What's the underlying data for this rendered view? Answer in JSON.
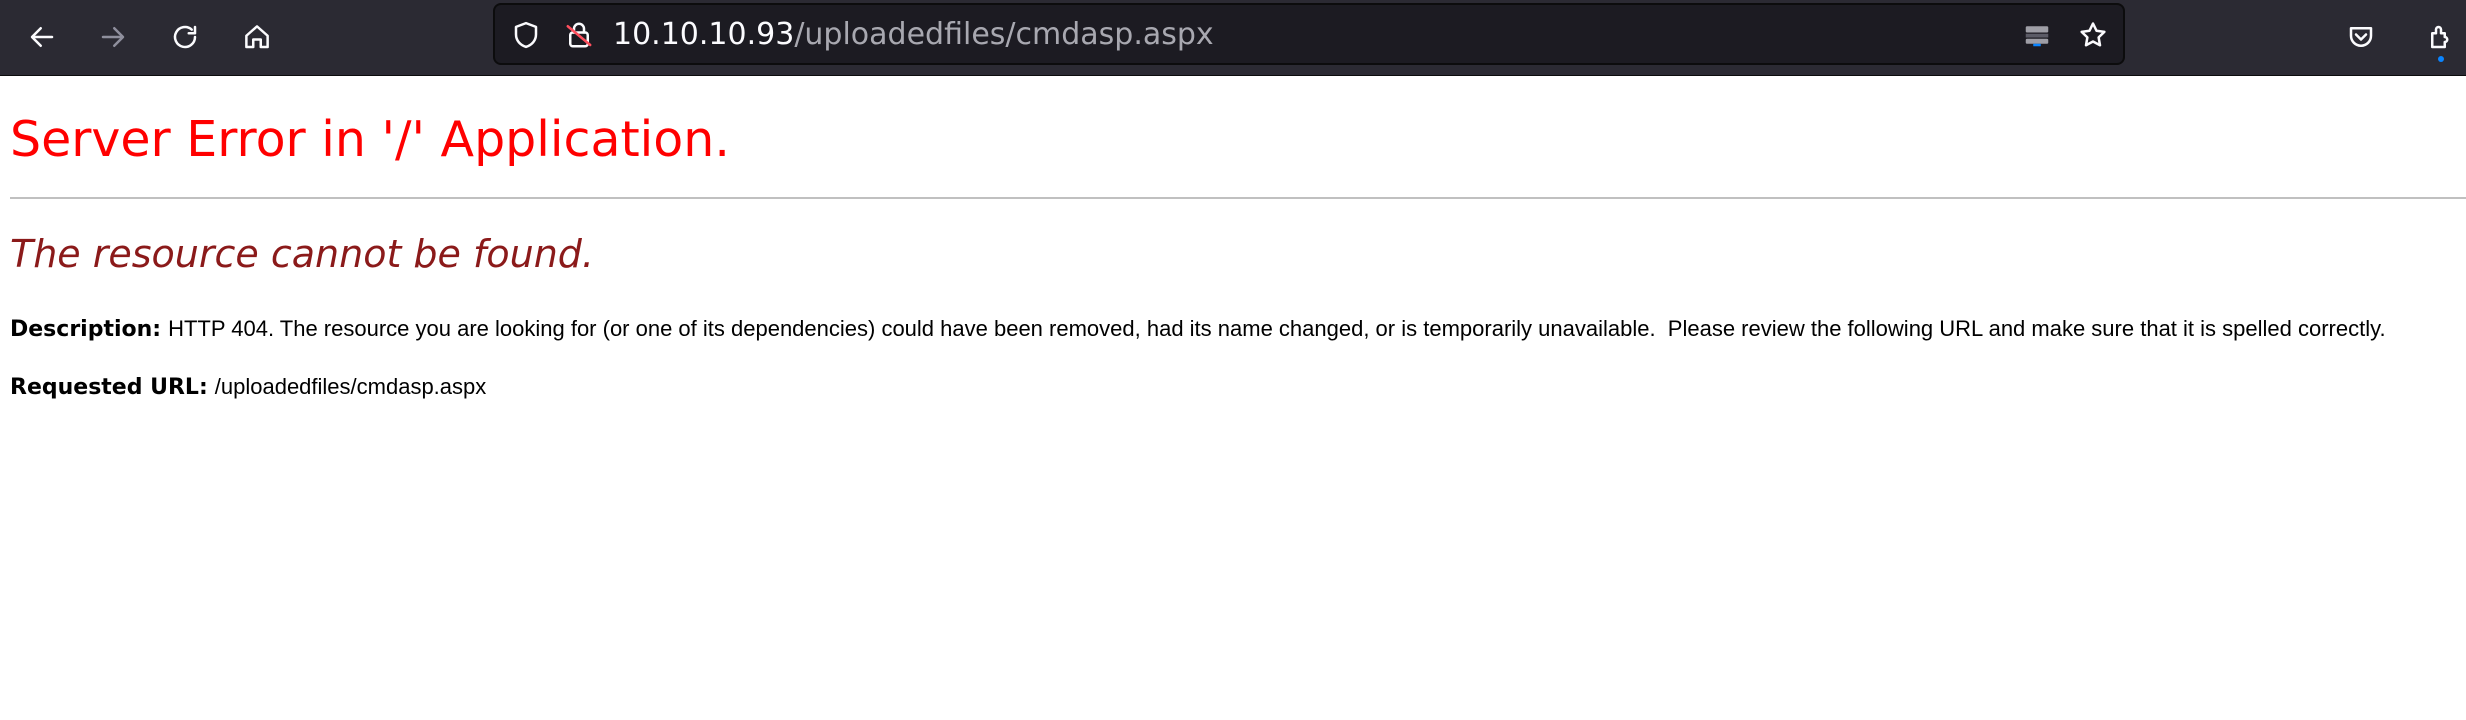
{
  "browser": {
    "url_host": "10.10.10.93",
    "url_path": "/uploadedfiles/cmdasp.aspx",
    "icons": [
      "back-arrow-icon",
      "forward-arrow-icon",
      "reload-icon",
      "home-icon",
      "shield-icon",
      "insecure-lock-icon",
      "reader-view-icon",
      "bookmark-star-icon",
      "pocket-icon",
      "extensions-icon"
    ]
  },
  "page": {
    "title": "Server Error in '/' Application.",
    "subtitle": "The resource cannot be found.",
    "description_label": "Description:",
    "description_text": "HTTP 404. The resource you are looking for (or one of its dependencies) could have been removed, had its name changed, or is temporarily unavailable.  Please review the following URL and make sure that it is spelled correctly.",
    "requested_url_label": "Requested URL:",
    "requested_url_value": "/uploadedfiles/cmdasp.aspx"
  },
  "colors": {
    "toolbar_bg": "#2b2a33",
    "urlbar_bg": "#1c1b22",
    "title_red": "#ff0000",
    "subtitle_maroon": "#8b1a1a",
    "accent_blue": "#0a84ff"
  }
}
